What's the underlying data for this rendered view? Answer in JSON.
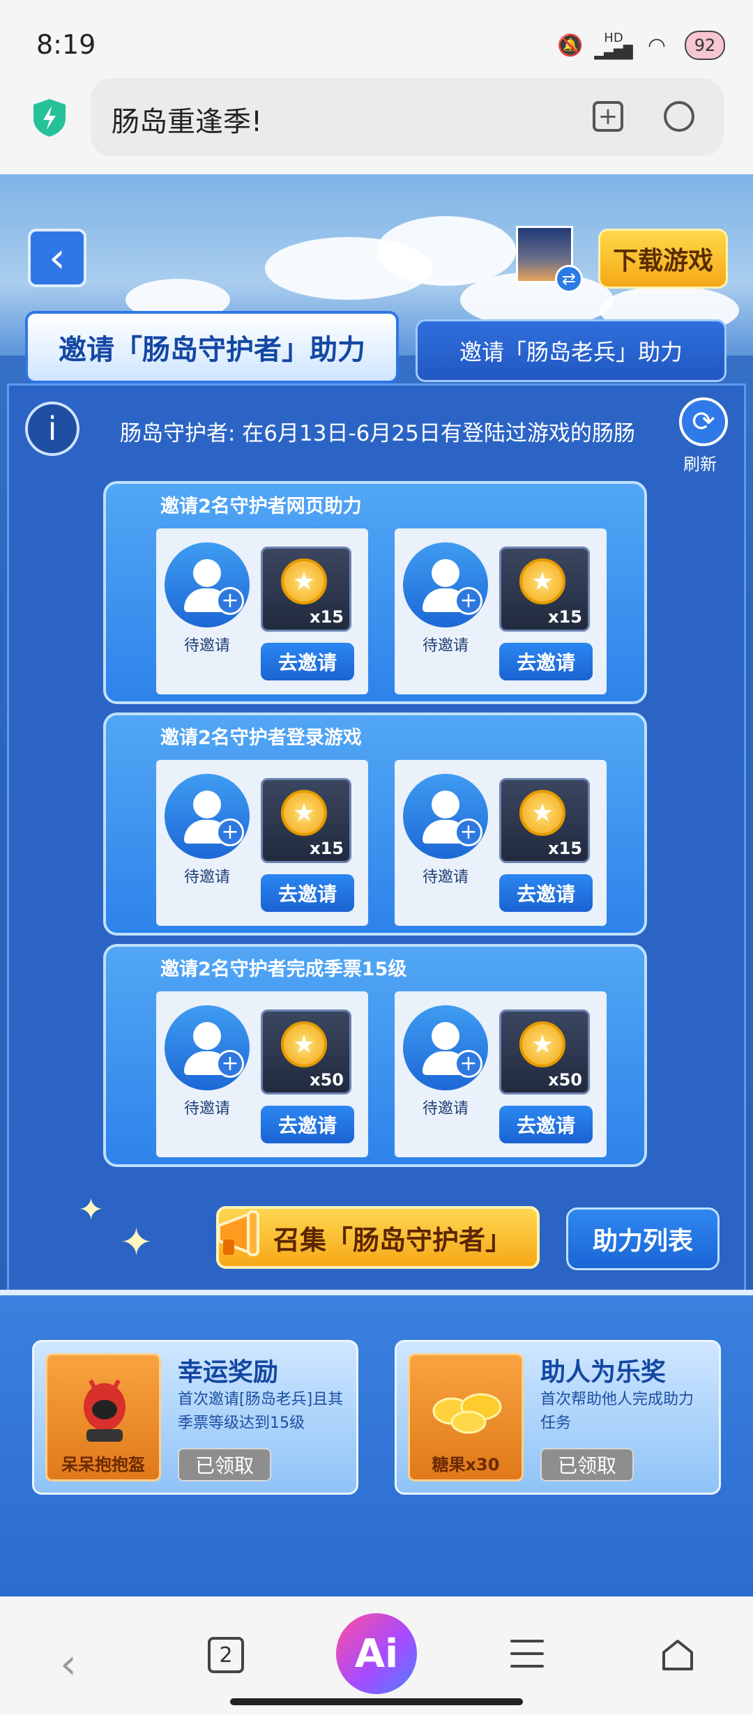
{
  "status_bar": {
    "time": "8:19",
    "network": "HD",
    "battery": "92"
  },
  "browser": {
    "address_title": "肠岛重逢季!"
  },
  "header": {
    "download_label": "下载游戏"
  },
  "tabs": [
    {
      "label": "邀请「肠岛守护者」助力",
      "active": true
    },
    {
      "label": "邀请「肠岛老兵」助力",
      "active": false
    }
  ],
  "info": {
    "description": "肠岛守护者: 在6月13日-6月25日有登陆过游戏的肠肠",
    "refresh_label": "刷新"
  },
  "groups": [
    {
      "title": "邀请2名守护者网页助力",
      "slots": [
        {
          "status": "待邀请",
          "reward_qty": "x15",
          "button": "去邀请"
        },
        {
          "status": "待邀请",
          "reward_qty": "x15",
          "button": "去邀请"
        }
      ]
    },
    {
      "title": "邀请2名守护者登录游戏",
      "slots": [
        {
          "status": "待邀请",
          "reward_qty": "x15",
          "button": "去邀请"
        },
        {
          "status": "待邀请",
          "reward_qty": "x15",
          "button": "去邀请"
        }
      ]
    },
    {
      "title": "邀请2名守护者完成季票15级",
      "slots": [
        {
          "status": "待邀请",
          "reward_qty": "x50",
          "button": "去邀请"
        },
        {
          "status": "待邀请",
          "reward_qty": "x50",
          "button": "去邀请"
        }
      ]
    }
  ],
  "actions": {
    "gather_label": "召集「肠岛守护者」",
    "help_list_label": "助力列表"
  },
  "rewards": [
    {
      "item_label": "呆呆抱抱盔",
      "title": "幸运奖励",
      "description": "首次邀请[肠岛老兵]且其季票等级达到15级",
      "status": "已领取"
    },
    {
      "item_label": "糖果x30",
      "title": "助人为乐奖",
      "description": "首次帮助他人完成助力任务",
      "status": "已领取"
    }
  ],
  "nav": {
    "tab_count": "2",
    "ai_label": "Ai"
  }
}
